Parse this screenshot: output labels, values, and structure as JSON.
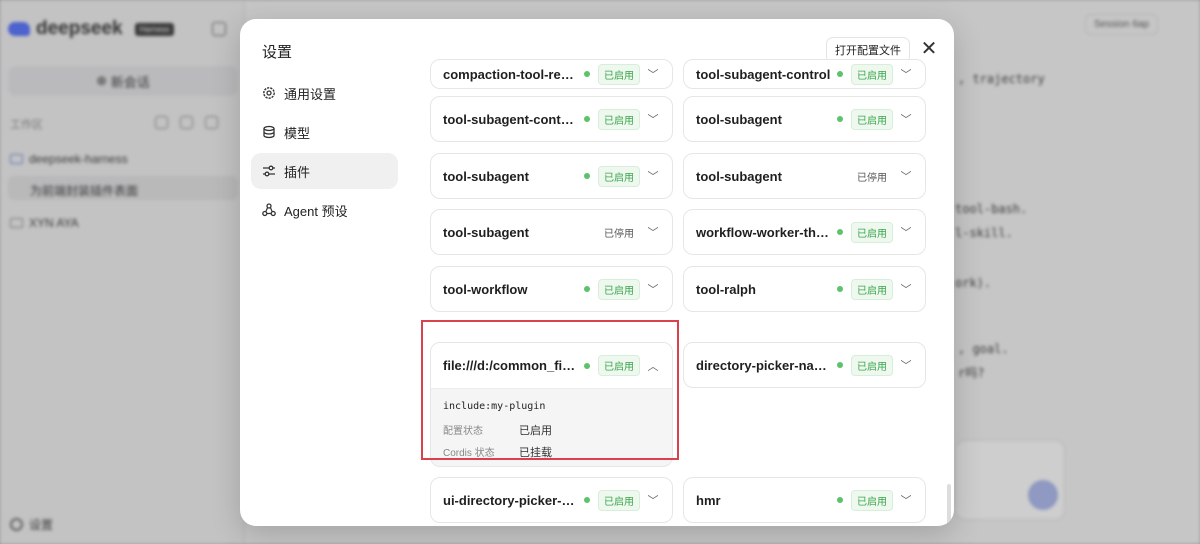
{
  "background": {
    "brand": "deepseek",
    "brand_badge": "Harness",
    "new_chat": "新会话",
    "workspace_label": "工作区",
    "folder1": "deepseek-harness",
    "selected_item": "为前端封装插件表面",
    "folder2": "XYN AYA",
    "settings": "设置",
    "session": "Session 6ap",
    "line1": ", trajectory",
    "line2": "tool-bash.",
    "line3": "l-skill.",
    "line4": "ork).",
    "line5": ", goal.",
    "line6": "r吗?"
  },
  "modal": {
    "title": "设置",
    "open_config": "打开配置文件",
    "close": "✕",
    "nav": [
      {
        "label": "通用设置",
        "icon": "gear-icon"
      },
      {
        "label": "模型",
        "icon": "database-icon"
      },
      {
        "label": "插件",
        "icon": "sliders-icon"
      },
      {
        "label": "Agent 预设",
        "icon": "agent-icon"
      }
    ],
    "plugins": {
      "partial_left": "compaction-tool-result",
      "partial_left_status": "已启用",
      "partial_right": "tool-subagent-control",
      "partial_right_status": "已启用",
      "r1_left": "tool-subagent-control-readonly",
      "r1_left_status": "已启用",
      "r1_right": "tool-subagent",
      "r1_right_status": "已启用",
      "r2_left": "tool-subagent",
      "r2_left_status": "已启用",
      "r2_right": "tool-subagent",
      "r2_right_status": "已停用",
      "r3_left": "tool-subagent",
      "r3_left_status": "已停用",
      "r3_right": "workflow-worker-thread",
      "r3_right_status": "已启用",
      "r4_left": "tool-workflow",
      "r4_left_status": "已启用",
      "r4_right": "tool-ralph",
      "r4_right_status": "已启用",
      "r5_right": "directory-picker-native",
      "r5_right_status": "已启用",
      "r6_left": "ui-directory-picker-native",
      "r6_left_status": "已启用",
      "r6_right": "hmr",
      "r6_right_status": "已启用"
    },
    "expanded": {
      "name": "file:///d:/common_files/my-plugin",
      "status": "已启用",
      "include": "include:my-plugin",
      "config_state_label": "配置状态",
      "config_state_value": "已启用",
      "cordis_label": "Cordis 状态",
      "cordis_value": "已挂载"
    }
  }
}
